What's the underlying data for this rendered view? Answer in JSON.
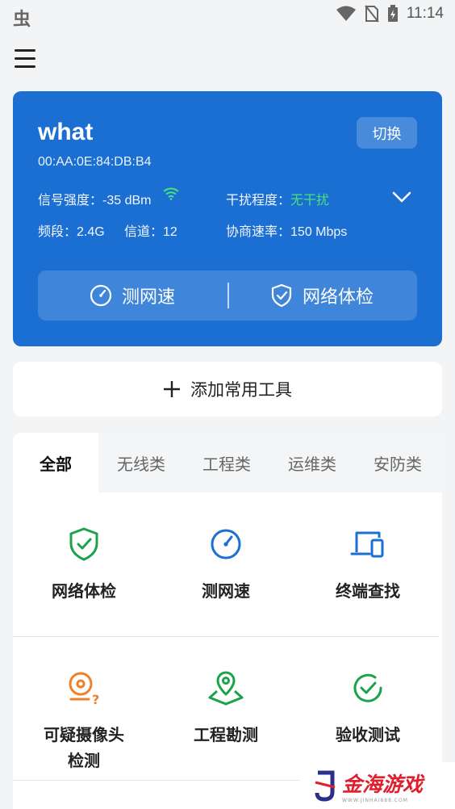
{
  "status_bar": {
    "left_glyph": "虫",
    "time": "11:14",
    "icons": [
      "wifi-icon",
      "no-sim-icon",
      "battery-charging-icon"
    ]
  },
  "header": {
    "menu_icon": "menu-icon"
  },
  "network": {
    "ssid": "what",
    "mac": "00:AA:0E:84:DB:B4",
    "switch_label": "切换",
    "signal_label": "信号强度：",
    "signal_value": "-35 dBm",
    "interference_label": "干扰程度：",
    "interference_value": "无干扰",
    "band_label": "频段：",
    "band_value": "2.4G",
    "channel_label": "信道：",
    "channel_value": "12",
    "rate_label": "协商速率：",
    "rate_value": "150 Mbps",
    "actions": [
      {
        "label": "测网速",
        "icon": "speedometer-icon"
      },
      {
        "label": "网络体检",
        "icon": "shield-check-icon"
      }
    ],
    "colors": {
      "card": "#1b6fd3",
      "good": "#4be07b"
    }
  },
  "add_tools": {
    "label": "添加常用工具"
  },
  "tabs": [
    {
      "label": "全部",
      "active": true
    },
    {
      "label": "无线类",
      "active": false
    },
    {
      "label": "工程类",
      "active": false
    },
    {
      "label": "运维类",
      "active": false
    },
    {
      "label": "安防类",
      "active": false
    }
  ],
  "tools": [
    {
      "label": "网络体检",
      "icon": "shield-check-icon",
      "color": "#1aa34a"
    },
    {
      "label": "测网速",
      "icon": "speedometer-icon",
      "color": "#1b6fd3"
    },
    {
      "label": "终端查找",
      "icon": "devices-icon",
      "color": "#1b6fd3"
    },
    {
      "label_line1": "可疑摄像头",
      "label_line2": "检测",
      "icon": "camera-question-icon",
      "color": "#f0802a"
    },
    {
      "label": "工程勘测",
      "icon": "map-pin-icon",
      "color": "#1aa34a"
    },
    {
      "label": "验收测试",
      "icon": "check-circle-icon",
      "color": "#1aa34a"
    }
  ],
  "watermark": {
    "logo_letter": "J",
    "text": "金海游戏",
    "sub": "WWW.JINHAI888.COM"
  }
}
